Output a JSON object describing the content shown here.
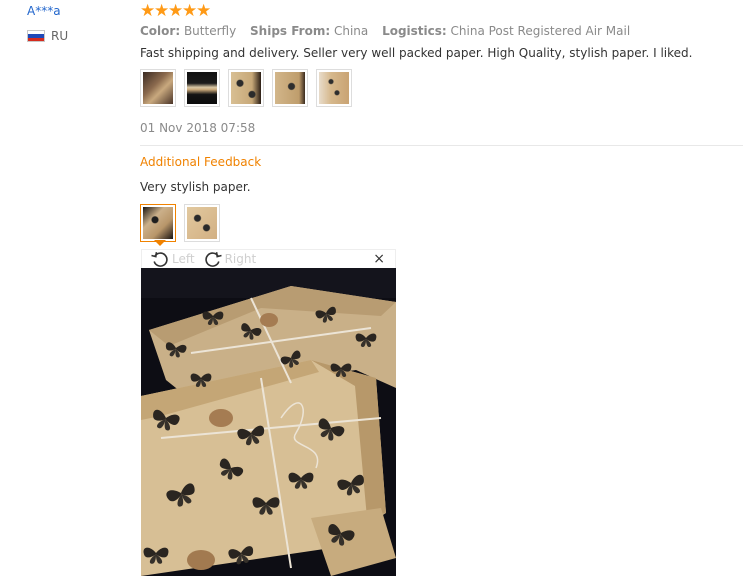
{
  "reviewer": {
    "name": "A***a",
    "country_code": "RU",
    "flag_colors": [
      "#ffffff",
      "#1f49b8",
      "#d52b1e"
    ]
  },
  "rating": {
    "stars": 5,
    "star_glyph": "★",
    "color": "#ff9a16"
  },
  "attributes": {
    "color_label": "Color:",
    "color_value": "Butterfly",
    "ships_from_label": "Ships From:",
    "ships_from_value": "China",
    "logistics_label": "Logistics:",
    "logistics_value": "China Post Registered Air Mail"
  },
  "feedback": {
    "text": "Fast shipping and delivery. Seller very well packed paper. High Quality, stylish paper. I liked.",
    "photos": [
      "photo-1",
      "photo-2",
      "photo-3",
      "photo-4",
      "photo-5"
    ],
    "date": "01 Nov 2018 07:58"
  },
  "additional_feedback": {
    "title": "Additional Feedback",
    "text": "Very stylish paper.",
    "photos": [
      "additional-photo-1",
      "additional-photo-2"
    ],
    "accent_color": "#f08200"
  },
  "viewer": {
    "rotate_left_label": "Left",
    "rotate_right_label": "Right",
    "close_glyph": "×",
    "icons": [
      "rotate-left-icon",
      "rotate-right-icon",
      "close-icon"
    ]
  }
}
